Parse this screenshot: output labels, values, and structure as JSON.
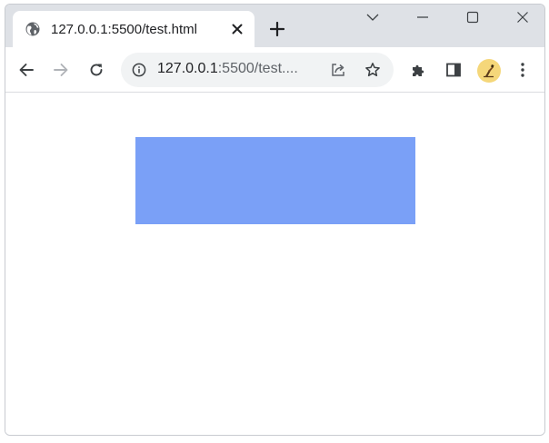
{
  "tab": {
    "title": "127.0.0.1:5500/test.html",
    "favicon": "globe-icon"
  },
  "omnibox": {
    "host": "127.0.0.1",
    "rest": ":5500/test...."
  },
  "colors": {
    "tabstrip": "#dee1e6",
    "omnibox": "#f1f3f4",
    "box": "#7aa0f7",
    "icon": "#5f6368",
    "icon_dark": "#3c4043",
    "forward_disabled": "#b0b3b8"
  },
  "icons": {
    "close": "close-icon",
    "new_tab": "plus-icon",
    "tab_search": "chevron-down-icon",
    "minimize": "minimize-icon",
    "maximize": "maximize-icon",
    "window_close": "close-icon",
    "back": "arrow-left-icon",
    "forward": "arrow-right-icon",
    "reload": "reload-icon",
    "site_info": "info-icon",
    "share": "share-icon",
    "bookmark": "star-icon",
    "extensions": "puzzle-icon",
    "side_panel": "side-panel-icon",
    "menu": "kebab-menu-icon"
  }
}
